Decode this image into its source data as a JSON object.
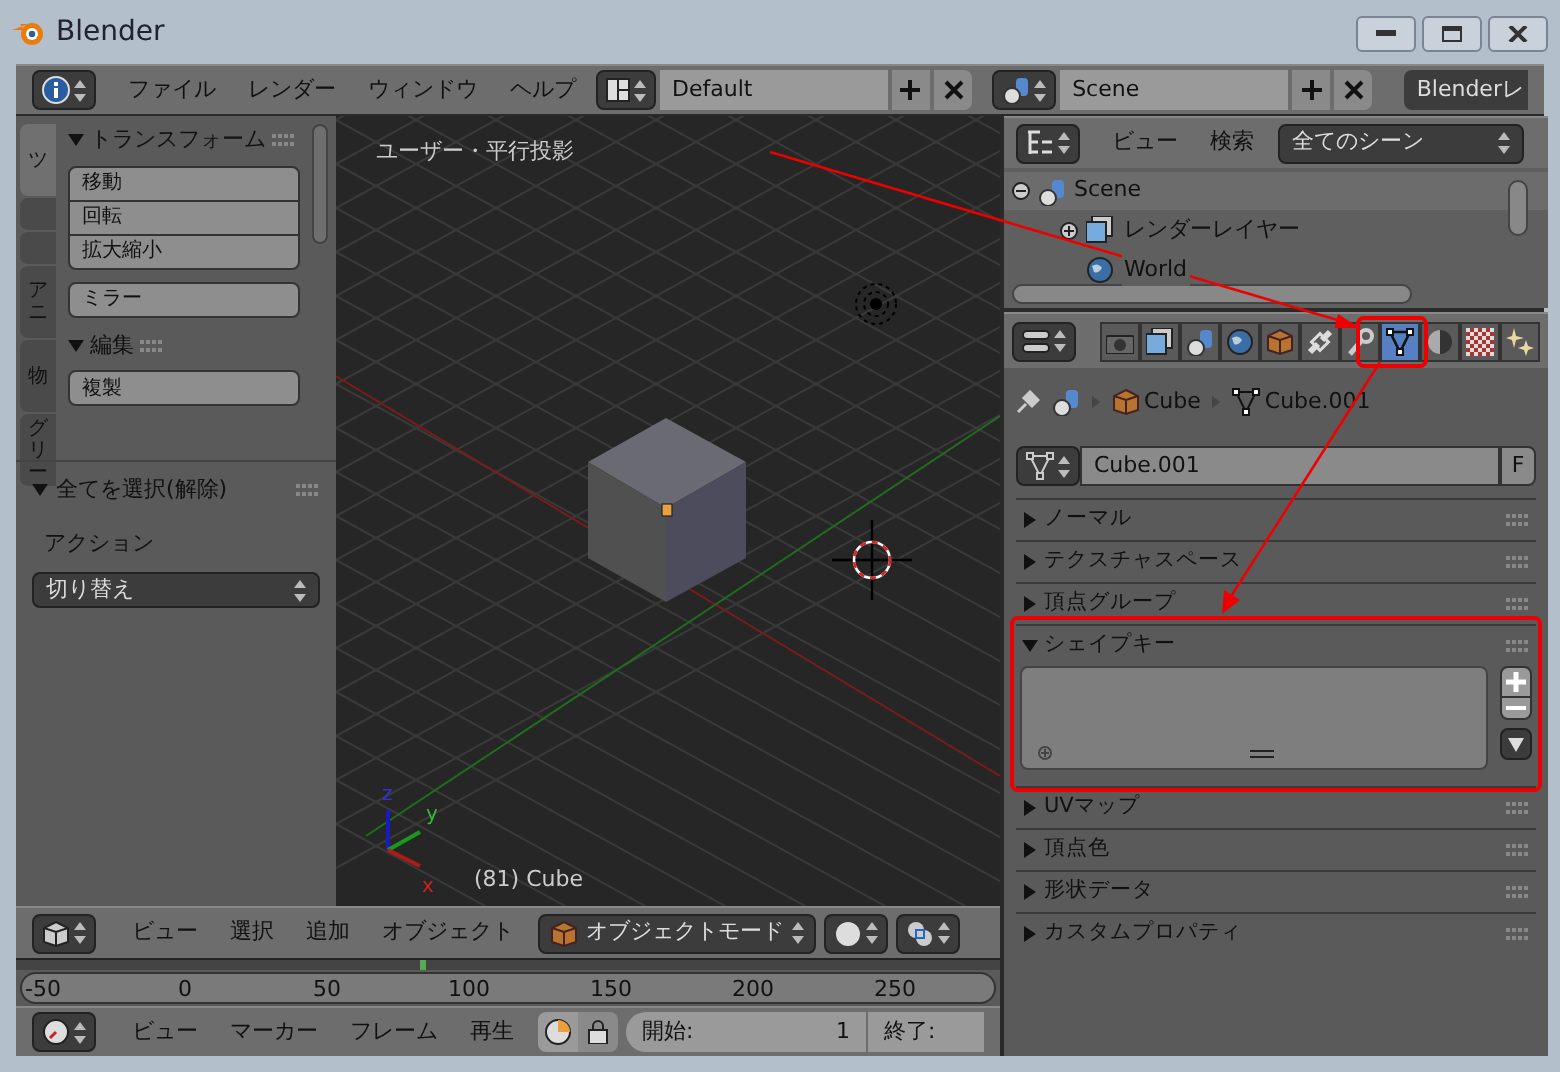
{
  "window": {
    "title": "Blender"
  },
  "info_header": {
    "menus": [
      "ファイル",
      "レンダー",
      "ウィンドウ",
      "ヘルプ"
    ],
    "layout": "Default",
    "scene": "Scene",
    "engine": "Blenderレ"
  },
  "tool_shelf": {
    "tabs": [
      {
        "label": "ツ",
        "selected": true
      },
      {
        "selected": false
      },
      {
        "selected": false
      },
      {
        "label": "アニ",
        "selected": false
      },
      {
        "label": "物",
        "selected": false
      },
      {
        "label": "グリー",
        "selected": false
      }
    ],
    "panels": [
      {
        "title": "トランスフォーム",
        "expanded": true,
        "groups": [
          [
            "移動",
            "回転",
            "拡大縮小"
          ],
          [
            "ミラー"
          ]
        ]
      },
      {
        "title": "編集",
        "expanded": true,
        "groups": [
          [
            "複製"
          ]
        ]
      }
    ]
  },
  "operator": {
    "title": "全てを選択(解除)",
    "expanded": true,
    "label": "アクション",
    "value": "切り替え"
  },
  "viewport": {
    "view_label": "ユーザー・平行投影",
    "object_label": "(81) Cube",
    "axes": [
      "z",
      "y",
      "x"
    ]
  },
  "view3d_header": {
    "menus": [
      "ビュー",
      "選択",
      "追加",
      "オブジェクト"
    ],
    "mode": "オブジェクトモード"
  },
  "timeline": {
    "ticks": [
      "-50",
      "0",
      "50",
      "100",
      "150",
      "200",
      "250"
    ],
    "level": 0.41
  },
  "timeline_header": {
    "menus": [
      "ビュー",
      "マーカー",
      "フレーム",
      "再生"
    ],
    "start_label": "開始:",
    "start_value": "1",
    "end_label": "終了:"
  },
  "outliner": {
    "menus": [
      "ビュー",
      "検索"
    ],
    "filter": "全てのシーン",
    "tree": [
      {
        "label": "Scene",
        "expanded": true,
        "selected": true,
        "children": [
          {
            "label": "レンダーレイヤー",
            "expanded": false,
            "selected": false
          },
          {
            "label": "World",
            "selected": false
          }
        ]
      }
    ]
  },
  "properties": {
    "tabs": [
      {
        "kind": "render",
        "selected": false
      },
      {
        "kind": "layers",
        "selected": false
      },
      {
        "kind": "scene",
        "selected": false
      },
      {
        "kind": "world",
        "selected": false
      },
      {
        "kind": "object",
        "selected": false
      },
      {
        "kind": "constraints",
        "selected": false
      },
      {
        "kind": "modifiers",
        "selected": false
      },
      {
        "kind": "data",
        "selected": true
      },
      {
        "kind": "material",
        "selected": false
      },
      {
        "kind": "texture",
        "selected": false
      },
      {
        "kind": "particles",
        "selected": false
      }
    ],
    "breadcrumb": [
      "Cube",
      "Cube.001"
    ],
    "datablock": {
      "value": "Cube.001",
      "button": "F"
    },
    "panels": [
      {
        "title": "ノーマル",
        "expanded": false
      },
      {
        "title": "テクスチャスペース",
        "expanded": false
      },
      {
        "title": "頂点グループ",
        "expanded": false
      },
      {
        "title": "シェイプキー",
        "expanded": true
      },
      {
        "title": "UVマップ",
        "expanded": false
      },
      {
        "title": "頂点色",
        "expanded": false
      },
      {
        "title": "形状データ",
        "expanded": false
      },
      {
        "title": "カスタムプロパティ",
        "expanded": false
      }
    ]
  }
}
